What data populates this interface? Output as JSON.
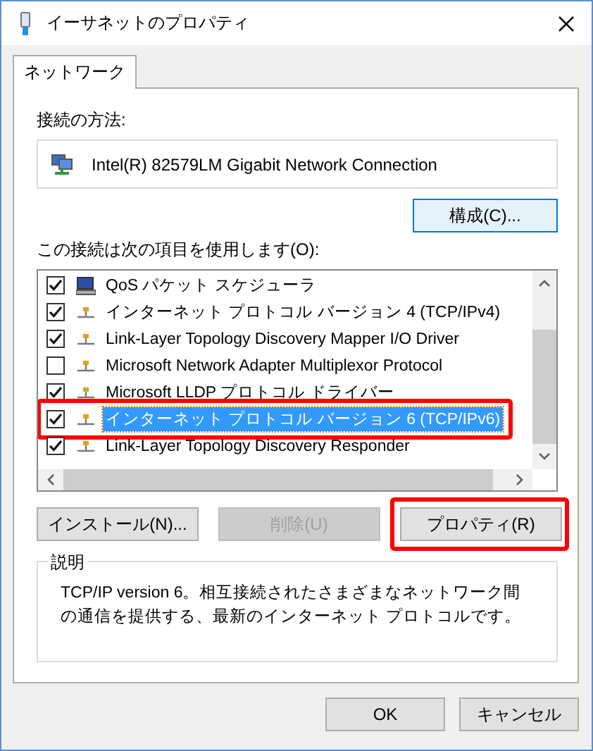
{
  "window": {
    "title": "イーサネットのプロパティ"
  },
  "tabs": [
    {
      "label": "ネットワーク",
      "selected": true
    }
  ],
  "connect_using": {
    "label": "接続の方法:",
    "adapter": "Intel(R) 82579LM Gigabit Network Connection",
    "configure_button": "構成(C)..."
  },
  "components": {
    "label": "この接続は次の項目を使用します(O):",
    "rows": [
      {
        "kind": "scheduler",
        "name": "QoS パケット スケジューラ",
        "checked": true,
        "selected": false,
        "highlighted": false
      },
      {
        "kind": "protocol",
        "name": "インターネット プロトコル バージョン 4 (TCP/IPv4)",
        "checked": true,
        "selected": false,
        "highlighted": false
      },
      {
        "kind": "protocol",
        "name": "Link-Layer Topology Discovery Mapper I/O Driver",
        "checked": true,
        "selected": false,
        "highlighted": false
      },
      {
        "kind": "protocol",
        "name": "Microsoft Network Adapter Multiplexor Protocol",
        "checked": false,
        "selected": false,
        "highlighted": false
      },
      {
        "kind": "protocol",
        "name": "Microsoft LLDP プロトコル ドライバー",
        "checked": true,
        "selected": false,
        "highlighted": false
      },
      {
        "kind": "protocol",
        "name": "インターネット プロトコル バージョン 6 (TCP/IPv6)",
        "checked": true,
        "selected": true,
        "highlighted": true
      },
      {
        "kind": "protocol",
        "name": "Link-Layer Topology Discovery Responder",
        "checked": true,
        "selected": false,
        "highlighted": false
      }
    ]
  },
  "buttons": [
    {
      "label": "インストール(N)...",
      "disabled": false,
      "highlighted": false
    },
    {
      "label": "削除(U)",
      "disabled": true,
      "highlighted": false
    },
    {
      "label": "プロパティ(R)",
      "disabled": false,
      "highlighted": true
    }
  ],
  "description": {
    "title": "説明",
    "text": "TCP/IP version 6。相互接続されたさまざまなネットワーク間の通信を提供する、最新のインターネット プロトコルです。"
  },
  "dialog_buttons": [
    "OK",
    "キャンセル"
  ]
}
